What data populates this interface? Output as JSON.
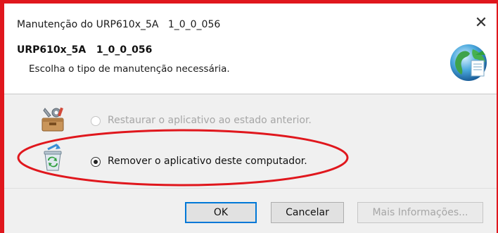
{
  "window": {
    "title": "Manutenção do URP610x_5A   1_0_0_056",
    "close_glyph": "✕"
  },
  "header": {
    "product_name": "URP610x_5A   1_0_0_056",
    "subtitle": "Escolha o tipo de manutenção necessária."
  },
  "options": [
    {
      "label": "Restaurar o aplicativo ao estado anterior.",
      "selected": false,
      "enabled": false,
      "icon": "toolbox-repair-icon"
    },
    {
      "label": "Remover o aplicativo deste computador.",
      "selected": true,
      "enabled": true,
      "icon": "recycle-bin-icon"
    }
  ],
  "buttons": {
    "ok": "OK",
    "cancel": "Cancelar",
    "more_info": "Mais Informações..."
  },
  "colors": {
    "annotation_red": "#e0171d",
    "focus_blue": "#0078d7",
    "panel_gray": "#f0f0f0"
  }
}
